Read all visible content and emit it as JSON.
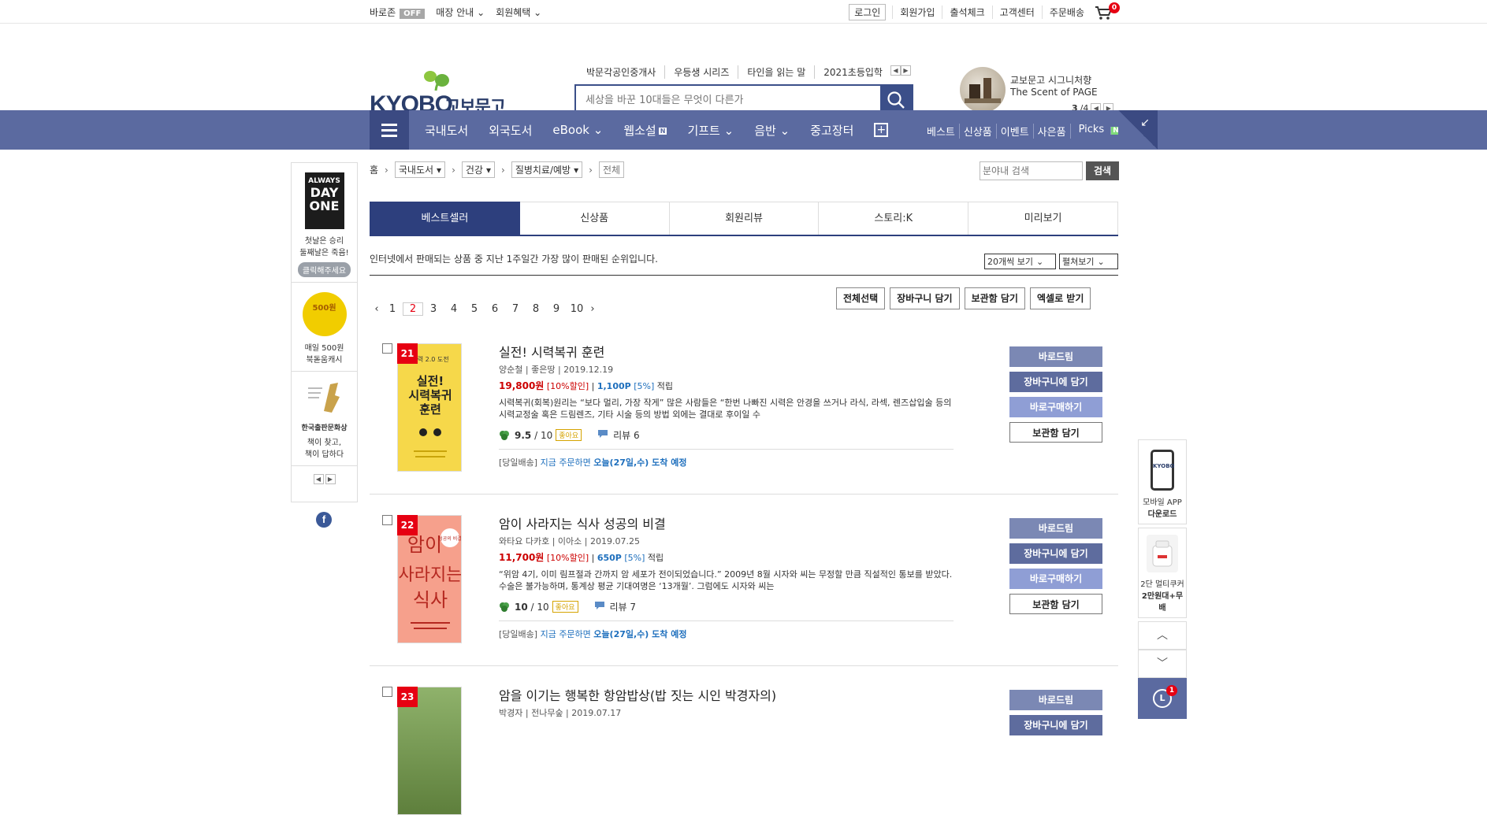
{
  "top_util": {
    "baro": "바로존",
    "off": "OFF",
    "store_info": "매장 안내",
    "member_benefit": "회원혜택",
    "login": "로그인",
    "join": "회원가입",
    "attendance": "출석체크",
    "customer_center": "고객센터",
    "order_delivery": "주문배송",
    "cart_count": "0"
  },
  "header": {
    "logo_en": "KYOBO",
    "logo_ko": "교보문고",
    "quick_links": [
      "박문각공인중개사",
      "우등생 시리즈",
      "타인을 읽는 말",
      "2021초등입학"
    ],
    "search_placeholder": "세상을 바꾼 10대들은 무엇이 다른가",
    "promo_line1": "교보문고 시그니처향",
    "promo_line2": "The Scent of PAGE",
    "promo_page": "3",
    "promo_total": "/4"
  },
  "gnb": {
    "items": [
      "국내도서",
      "외국도서",
      "eBook",
      "웹소설",
      "기프트",
      "음반",
      "중고장터"
    ],
    "web_novel_badge": "N",
    "right": [
      "베스트",
      "신상품",
      "이벤트",
      "사은품",
      "Picks"
    ],
    "picks_badge": "N"
  },
  "left_banner": {
    "book_line1": "ALWAYS",
    "book_line2": "DAY",
    "book_line3": "ONE",
    "book_caption1": "첫날은 승리",
    "book_caption2": "둘째날은 죽음!",
    "click": "클릭해주세요",
    "coin": "500원",
    "coin_caption1": "매일 500원",
    "coin_caption2": "북돋움캐시",
    "award_caption1": "한국출판문화상",
    "award_caption2": "책이 찾고,",
    "award_caption3": "책이 답하다"
  },
  "breadcrumb": {
    "home": "홈",
    "c1": "국내도서",
    "c2": "건강",
    "c3": "질병치료/예방",
    "current": "전체"
  },
  "inner_search": {
    "placeholder": "분야내 검색",
    "button": "검색"
  },
  "tabs": [
    "베스트셀러",
    "신상품",
    "회원리뷰",
    "스토리:K",
    "미리보기"
  ],
  "description": "인터넷에서 판매되는 상품 중 지난 1주일간 가장 많이 판매된 순위입니다.",
  "view_count": "20개씩 보기",
  "view_mode": "펼쳐보기",
  "pagination": [
    "1",
    "2",
    "3",
    "4",
    "5",
    "6",
    "7",
    "8",
    "9",
    "10"
  ],
  "action_buttons": [
    "전체선택",
    "장바구니 담기",
    "보관함 담기",
    "엑셀로 받기"
  ],
  "items": [
    {
      "rank": "21",
      "title": "실전! 시력복귀 훈련",
      "author": "양순철",
      "publisher": "좋은땅",
      "date": "2019.12.19",
      "price": "19,800원",
      "discount": "[10%할인]",
      "point": "1,100P",
      "point_pct": "[5%]",
      "point_label": "적립",
      "desc": "시력복귀(회복)원리는 “보다 멀리, 가장 작게” 많은 사람들은 “한번 나빠진 시력은 안경을 쓰거나 라식, 라섹, 렌즈삽입술 등의 시력교정술 혹은 드림렌즈, 기타 시술 등의 방법 외에는 결대로 후이일 수",
      "rating": "9.5",
      "rating_max": "/ 10",
      "rating_badge": "좋아요",
      "reviews": "리뷰 6",
      "delivery_label": "[당일배송]",
      "delivery_text": "지금 주문하면",
      "delivery_date": "오늘(27일,수) 도착 예정",
      "cover_title": "실전! 시력복귀 훈련",
      "cover_sub": "시력 2.0 도전"
    },
    {
      "rank": "22",
      "title": "암이 사라지는 식사 성공의 비결",
      "author": "와타요 다카호",
      "publisher": "이아소",
      "date": "2019.07.25",
      "price": "11,700원",
      "discount": "[10%할인]",
      "point": "650P",
      "point_pct": "[5%]",
      "point_label": "적립",
      "desc": "“위암 4기, 이미 림프절과 간까지 암 세포가 전이되었습니다.” 2009년 8월 시자와 씨는 무정할 만큼 직설적인 통보를 받았다. 수술은 불가능하며, 통계상 평균 기대여명은 ‘13개월’. 그럼에도 시자와 씨는",
      "rating": "10",
      "rating_max": "/ 10",
      "rating_badge": "좋아요",
      "reviews": "리뷰 7",
      "delivery_label": "[당일배송]",
      "delivery_text": "지금 주문하면",
      "delivery_date": "오늘(27일,수) 도착 예정",
      "cover_title": "암이 사라지는 식사",
      "cover_sub": "성공의 비결"
    },
    {
      "rank": "23",
      "title": "암을 이기는 행복한 항암밥상(밥 짓는 시인 박경자의)",
      "author": "박경자",
      "publisher": "전나무숲",
      "date": "2019.07.17"
    }
  ],
  "item_buttons": [
    "바로드림",
    "장바구니에 담기",
    "바로구매하기",
    "보관함 담기"
  ],
  "right_quick": {
    "app_line1": "모바일 APP",
    "app_line2": "다운로드",
    "cooker_line1": "2단 멀티쿠커",
    "cooker_line2": "2만원대+무배",
    "recent_count": "1"
  }
}
